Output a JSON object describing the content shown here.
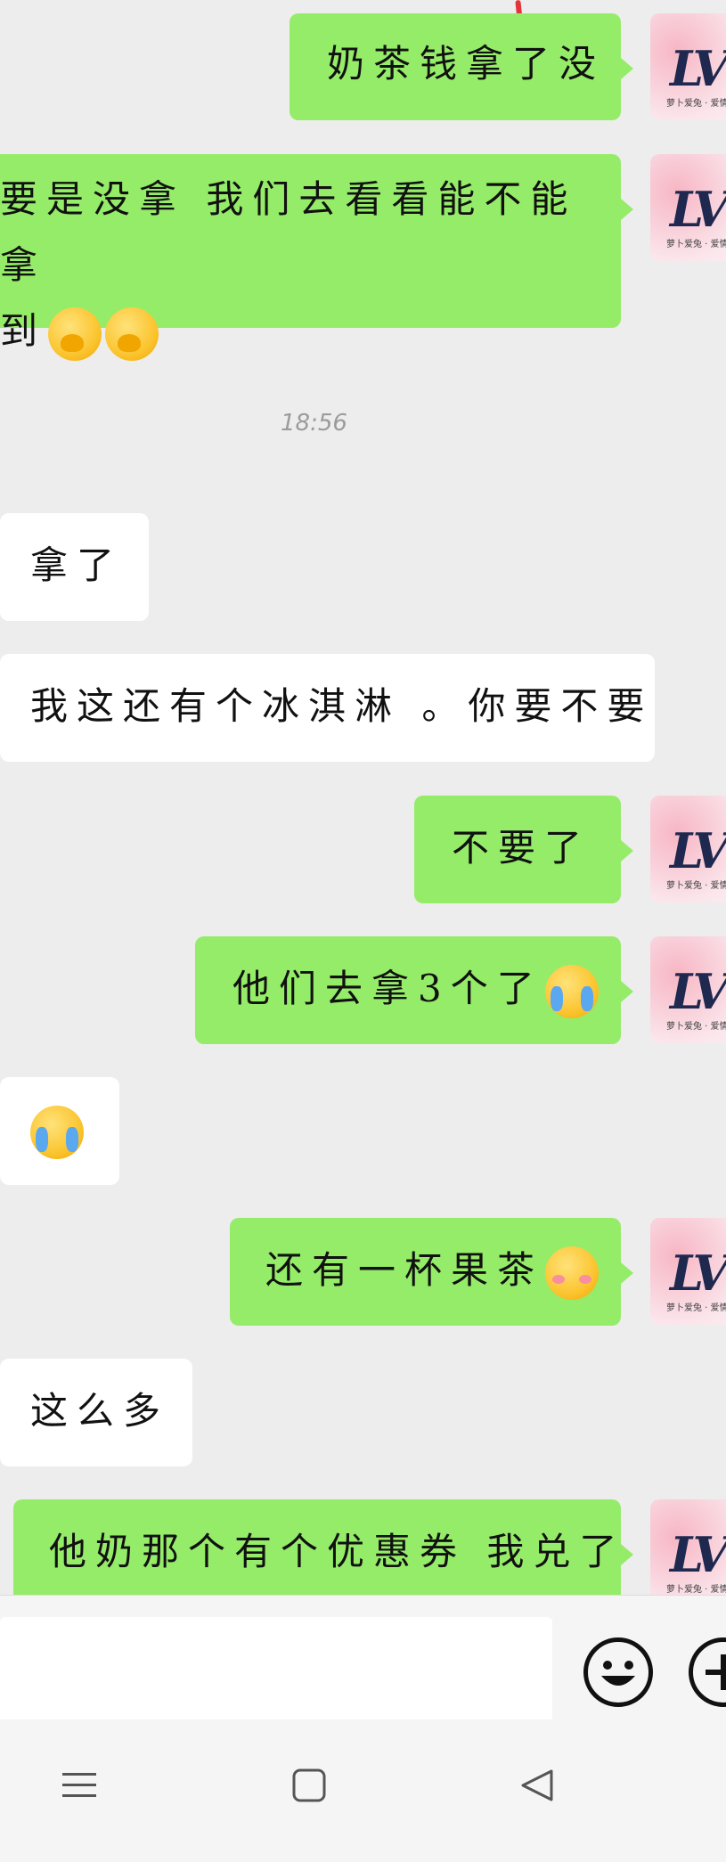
{
  "messages": [
    {
      "side": "out",
      "text": "奶茶钱拿了没",
      "emoji": []
    },
    {
      "side": "out",
      "line1": "要是没拿 我们去看看能不能拿",
      "line2": "到",
      "emoji": [
        "hand-over-mouth-emoji",
        "hand-over-mouth-emoji"
      ]
    },
    {
      "side": "time",
      "text": "18:56"
    },
    {
      "side": "in",
      "text": "拿了"
    },
    {
      "side": "in",
      "text": "我这还有个冰淇淋 。你要不要"
    },
    {
      "side": "out",
      "text": "不要了"
    },
    {
      "side": "out",
      "text": "他们去拿3个了",
      "emoji": [
        "crying-laughing-emoji"
      ]
    },
    {
      "side": "in",
      "text": "",
      "emoji": [
        "crying-laughing-emoji"
      ]
    },
    {
      "side": "out",
      "text": "还有一杯果茶",
      "emoji": [
        "shy-smile-emoji"
      ]
    },
    {
      "side": "in",
      "text": "这么多"
    },
    {
      "side": "out",
      "text": "他奶那个有个优惠券 我兑了"
    }
  ],
  "avatar": {
    "text": "LV",
    "caption": "萝卜爱兔 · 爱情"
  },
  "colors": {
    "outgoing_bubble": "#95ec69",
    "incoming_bubble": "#ffffff",
    "background": "#ededed"
  },
  "input_bar": {
    "emoji_icon": "smiley-face-icon",
    "plus_icon": "plus-icon"
  },
  "nav_bar": {
    "icons": [
      "menu-icon",
      "home-square-icon",
      "back-triangle-icon"
    ]
  }
}
